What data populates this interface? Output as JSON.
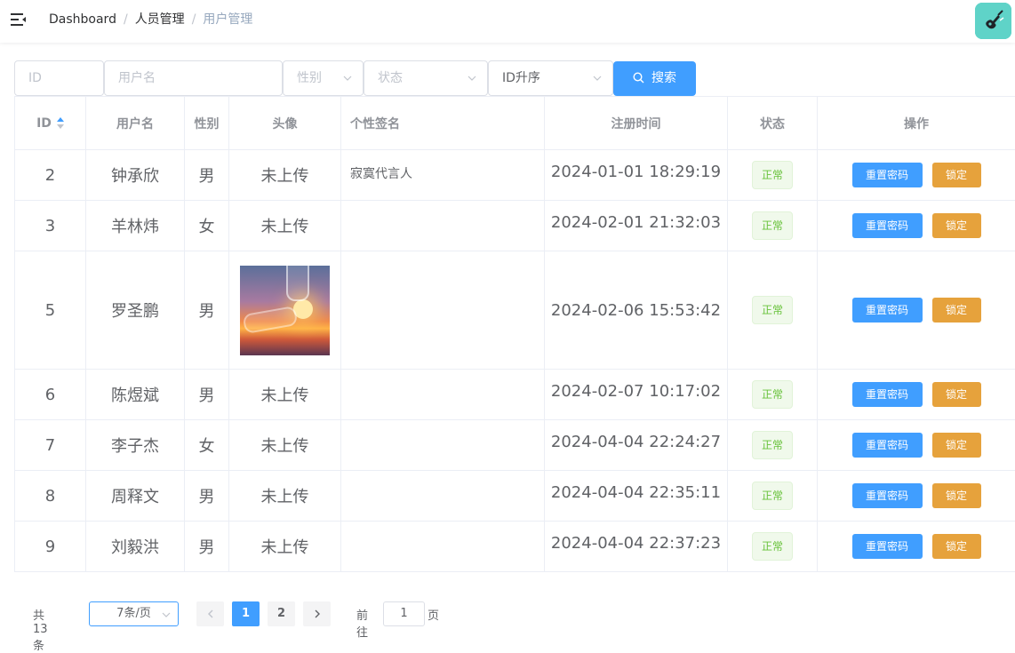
{
  "breadcrumb": [
    "Dashboard",
    "人员管理",
    "用户管理"
  ],
  "filters": {
    "id_placeholder": "ID",
    "username_placeholder": "用户名",
    "gender_placeholder": "性别",
    "status_placeholder": "状态",
    "sort_value": "ID升序",
    "search_label": "搜索"
  },
  "table": {
    "headers": [
      "ID",
      "用户名",
      "性别",
      "头像",
      "个性签名",
      "注册时间",
      "状态",
      "操作"
    ],
    "rows": [
      {
        "id": "2",
        "username": "钟承欣",
        "gender": "男",
        "avatar": "未上传",
        "signature": "寂寞代言人",
        "registered": "2024-01-01 18:29:19",
        "status": "正常"
      },
      {
        "id": "3",
        "username": "羊林炜",
        "gender": "女",
        "avatar": "未上传",
        "signature": "",
        "registered": "2024-02-01 21:32:03",
        "status": "正常"
      },
      {
        "id": "5",
        "username": "罗圣鹏",
        "gender": "男",
        "avatar": "",
        "signature": "",
        "registered": "2024-02-06 15:53:42",
        "status": "正常"
      },
      {
        "id": "6",
        "username": "陈煜斌",
        "gender": "男",
        "avatar": "未上传",
        "signature": "",
        "registered": "2024-02-07 10:17:02",
        "status": "正常"
      },
      {
        "id": "7",
        "username": "李子杰",
        "gender": "女",
        "avatar": "未上传",
        "signature": "",
        "registered": "2024-04-04 22:24:27",
        "status": "正常"
      },
      {
        "id": "8",
        "username": "周释文",
        "gender": "男",
        "avatar": "未上传",
        "signature": "",
        "registered": "2024-04-04 22:35:11",
        "status": "正常"
      },
      {
        "id": "9",
        "username": "刘毅洪",
        "gender": "男",
        "avatar": "未上传",
        "signature": "",
        "registered": "2024-04-04 22:37:23",
        "status": "正常"
      }
    ],
    "actions": {
      "reset": "重置密码",
      "lock": "锁定"
    }
  },
  "pagination": {
    "total": "共 13 条",
    "page_size": "7条/页",
    "pages": [
      "1",
      "2"
    ],
    "current": "1",
    "goto_prefix": "前往",
    "goto_value": "1",
    "goto_suffix": "页"
  },
  "colors": {
    "primary": "#409eff",
    "warning": "#e6a23c",
    "success": "#67c23a"
  }
}
